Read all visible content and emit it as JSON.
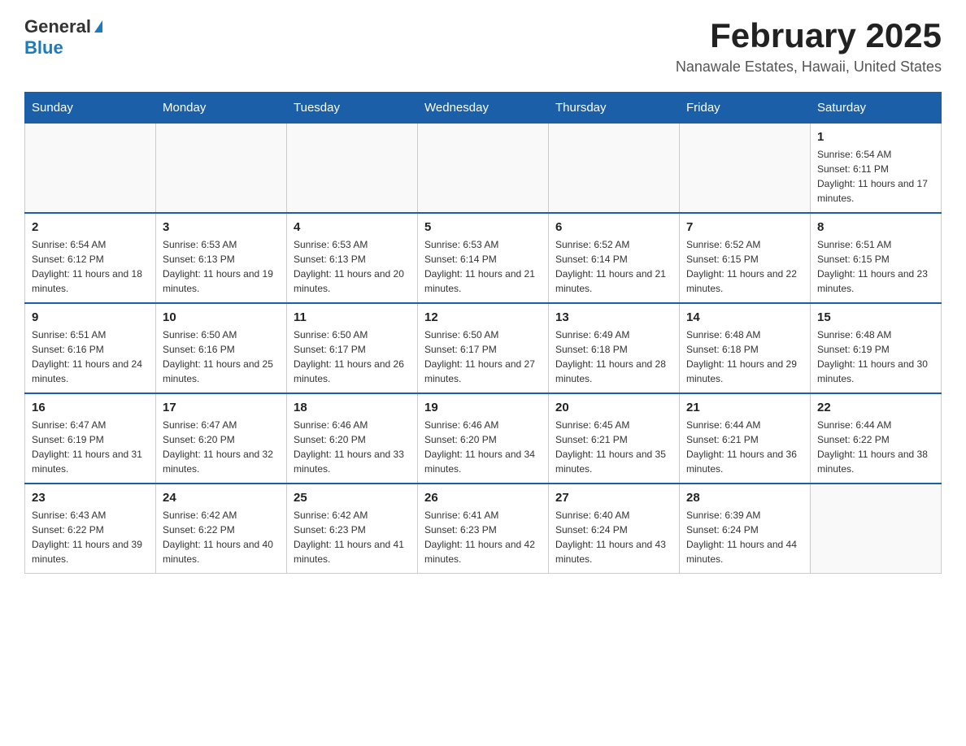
{
  "header": {
    "logo_general": "General",
    "logo_blue": "Blue",
    "title": "February 2025",
    "subtitle": "Nanawale Estates, Hawaii, United States"
  },
  "weekdays": [
    "Sunday",
    "Monday",
    "Tuesday",
    "Wednesday",
    "Thursday",
    "Friday",
    "Saturday"
  ],
  "weeks": [
    [
      {
        "day": "",
        "info": ""
      },
      {
        "day": "",
        "info": ""
      },
      {
        "day": "",
        "info": ""
      },
      {
        "day": "",
        "info": ""
      },
      {
        "day": "",
        "info": ""
      },
      {
        "day": "",
        "info": ""
      },
      {
        "day": "1",
        "info": "Sunrise: 6:54 AM\nSunset: 6:11 PM\nDaylight: 11 hours and 17 minutes."
      }
    ],
    [
      {
        "day": "2",
        "info": "Sunrise: 6:54 AM\nSunset: 6:12 PM\nDaylight: 11 hours and 18 minutes."
      },
      {
        "day": "3",
        "info": "Sunrise: 6:53 AM\nSunset: 6:13 PM\nDaylight: 11 hours and 19 minutes."
      },
      {
        "day": "4",
        "info": "Sunrise: 6:53 AM\nSunset: 6:13 PM\nDaylight: 11 hours and 20 minutes."
      },
      {
        "day": "5",
        "info": "Sunrise: 6:53 AM\nSunset: 6:14 PM\nDaylight: 11 hours and 21 minutes."
      },
      {
        "day": "6",
        "info": "Sunrise: 6:52 AM\nSunset: 6:14 PM\nDaylight: 11 hours and 21 minutes."
      },
      {
        "day": "7",
        "info": "Sunrise: 6:52 AM\nSunset: 6:15 PM\nDaylight: 11 hours and 22 minutes."
      },
      {
        "day": "8",
        "info": "Sunrise: 6:51 AM\nSunset: 6:15 PM\nDaylight: 11 hours and 23 minutes."
      }
    ],
    [
      {
        "day": "9",
        "info": "Sunrise: 6:51 AM\nSunset: 6:16 PM\nDaylight: 11 hours and 24 minutes."
      },
      {
        "day": "10",
        "info": "Sunrise: 6:50 AM\nSunset: 6:16 PM\nDaylight: 11 hours and 25 minutes."
      },
      {
        "day": "11",
        "info": "Sunrise: 6:50 AM\nSunset: 6:17 PM\nDaylight: 11 hours and 26 minutes."
      },
      {
        "day": "12",
        "info": "Sunrise: 6:50 AM\nSunset: 6:17 PM\nDaylight: 11 hours and 27 minutes."
      },
      {
        "day": "13",
        "info": "Sunrise: 6:49 AM\nSunset: 6:18 PM\nDaylight: 11 hours and 28 minutes."
      },
      {
        "day": "14",
        "info": "Sunrise: 6:48 AM\nSunset: 6:18 PM\nDaylight: 11 hours and 29 minutes."
      },
      {
        "day": "15",
        "info": "Sunrise: 6:48 AM\nSunset: 6:19 PM\nDaylight: 11 hours and 30 minutes."
      }
    ],
    [
      {
        "day": "16",
        "info": "Sunrise: 6:47 AM\nSunset: 6:19 PM\nDaylight: 11 hours and 31 minutes."
      },
      {
        "day": "17",
        "info": "Sunrise: 6:47 AM\nSunset: 6:20 PM\nDaylight: 11 hours and 32 minutes."
      },
      {
        "day": "18",
        "info": "Sunrise: 6:46 AM\nSunset: 6:20 PM\nDaylight: 11 hours and 33 minutes."
      },
      {
        "day": "19",
        "info": "Sunrise: 6:46 AM\nSunset: 6:20 PM\nDaylight: 11 hours and 34 minutes."
      },
      {
        "day": "20",
        "info": "Sunrise: 6:45 AM\nSunset: 6:21 PM\nDaylight: 11 hours and 35 minutes."
      },
      {
        "day": "21",
        "info": "Sunrise: 6:44 AM\nSunset: 6:21 PM\nDaylight: 11 hours and 36 minutes."
      },
      {
        "day": "22",
        "info": "Sunrise: 6:44 AM\nSunset: 6:22 PM\nDaylight: 11 hours and 38 minutes."
      }
    ],
    [
      {
        "day": "23",
        "info": "Sunrise: 6:43 AM\nSunset: 6:22 PM\nDaylight: 11 hours and 39 minutes."
      },
      {
        "day": "24",
        "info": "Sunrise: 6:42 AM\nSunset: 6:22 PM\nDaylight: 11 hours and 40 minutes."
      },
      {
        "day": "25",
        "info": "Sunrise: 6:42 AM\nSunset: 6:23 PM\nDaylight: 11 hours and 41 minutes."
      },
      {
        "day": "26",
        "info": "Sunrise: 6:41 AM\nSunset: 6:23 PM\nDaylight: 11 hours and 42 minutes."
      },
      {
        "day": "27",
        "info": "Sunrise: 6:40 AM\nSunset: 6:24 PM\nDaylight: 11 hours and 43 minutes."
      },
      {
        "day": "28",
        "info": "Sunrise: 6:39 AM\nSunset: 6:24 PM\nDaylight: 11 hours and 44 minutes."
      },
      {
        "day": "",
        "info": ""
      }
    ]
  ]
}
